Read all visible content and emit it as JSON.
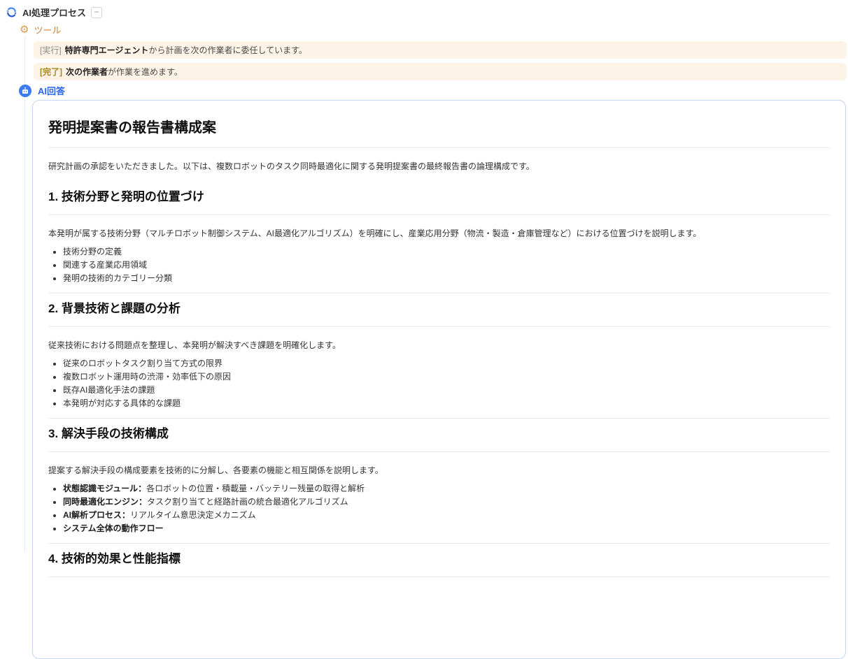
{
  "header": {
    "title": "AI処理プロセス",
    "collapse_button_label": "−"
  },
  "tools": {
    "label": "ツール"
  },
  "status_messages": [
    {
      "tag": "[実行]",
      "bold": "特許専門エージェント",
      "text": "から計画を次の作業者に委任しています。"
    },
    {
      "tag": "[完了]",
      "bold": "次の作業者",
      "text": "が作業を進めます。"
    }
  ],
  "ai_answer": {
    "label": "AI回答",
    "document": {
      "title": "発明提案書の報告書構成案",
      "intro": "研究計画の承認をいただきました。以下は、複数ロボットのタスク同時最適化に関する発明提案書の最終報告書の論理構成です。",
      "sections": [
        {
          "heading": "1. 技術分野と発明の位置づけ",
          "paragraph": "本発明が属する技術分野（マルチロボット制御システム、AI最適化アルゴリズム）を明確にし、産業応用分野（物流・製造・倉庫管理など）における位置づけを説明します。",
          "bullets": [
            {
              "bold": "",
              "text": "技術分野の定義"
            },
            {
              "bold": "",
              "text": "関連する産業応用領域"
            },
            {
              "bold": "",
              "text": "発明の技術的カテゴリー分類"
            }
          ]
        },
        {
          "heading": "2. 背景技術と課題の分析",
          "paragraph": "従来技術における問題点を整理し、本発明が解決すべき課題を明確化します。",
          "bullets": [
            {
              "bold": "",
              "text": "従来のロボットタスク割り当て方式の限界"
            },
            {
              "bold": "",
              "text": "複数ロボット運用時の渋滞・効率低下の原因"
            },
            {
              "bold": "",
              "text": "既存AI最適化手法の課題"
            },
            {
              "bold": "",
              "text": "本発明が対応する具体的な課題"
            }
          ]
        },
        {
          "heading": "3. 解決手段の技術構成",
          "paragraph": "提案する解決手段の構成要素を技術的に分解し、各要素の機能と相互関係を説明します。",
          "bullets": [
            {
              "bold": "状態認識モジュール：",
              "text": "各ロボットの位置・積載量・バッテリー残量の取得と解析"
            },
            {
              "bold": "同時最適化エンジン：",
              "text": "タスク割り当てと経路計画の統合最適化アルゴリズム"
            },
            {
              "bold": "AI解析プロセス：",
              "text": "リアルタイム意思決定メカニズム"
            },
            {
              "bold": "システム全体の動作フロー",
              "text": ""
            }
          ]
        },
        {
          "heading": "4. 技術的効果と性能指標",
          "paragraph": "",
          "bullets": []
        }
      ]
    }
  },
  "icons": {
    "logo": "sync-arrows-icon",
    "tools": "gear-icon",
    "answer": "robot-icon",
    "collapse": "minus-icon"
  },
  "colors": {
    "accent_blue": "#2767e8",
    "icon_blue": "#3b7af0",
    "tool_orange": "#cf8540",
    "status_bg": "#fdf3e7",
    "run_tag": "#8f8f8f",
    "done_tag": "#a6871e",
    "panel_border": "#c5d7f2",
    "rule_gray": "#e4e7ec"
  }
}
